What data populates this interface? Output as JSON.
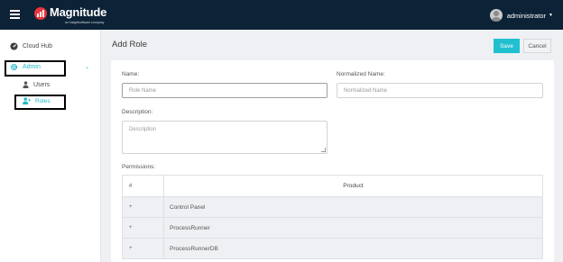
{
  "header": {
    "brand": "Magnitude",
    "brand_sub": "an insightsoftware company",
    "user_name": "administrator"
  },
  "sidebar": {
    "items": [
      {
        "label": "Cloud Hub"
      },
      {
        "label": "Admin"
      },
      {
        "label": "Users"
      },
      {
        "label": "Roles"
      }
    ]
  },
  "page": {
    "title": "Add Role",
    "save_label": "Save",
    "cancel_label": "Cancel"
  },
  "form": {
    "name_label": "Name:",
    "name_placeholder": "Role Name",
    "normalized_label": "Normalized Name:",
    "normalized_placeholder": "Normalized Name",
    "description_label": "Description:",
    "description_placeholder": "Description",
    "permissions_label": "Permissions:"
  },
  "permissions_table": {
    "headers": [
      "#",
      "Product"
    ],
    "rows": [
      {
        "marker": "+",
        "product": "Control Panel"
      },
      {
        "marker": "+",
        "product": "ProcessRunner"
      },
      {
        "marker": "+",
        "product": "ProcessRunnerDB"
      }
    ]
  },
  "colors": {
    "topbar": "#0c2236",
    "accent": "#21c0d0",
    "brand_red": "#e8343b"
  }
}
